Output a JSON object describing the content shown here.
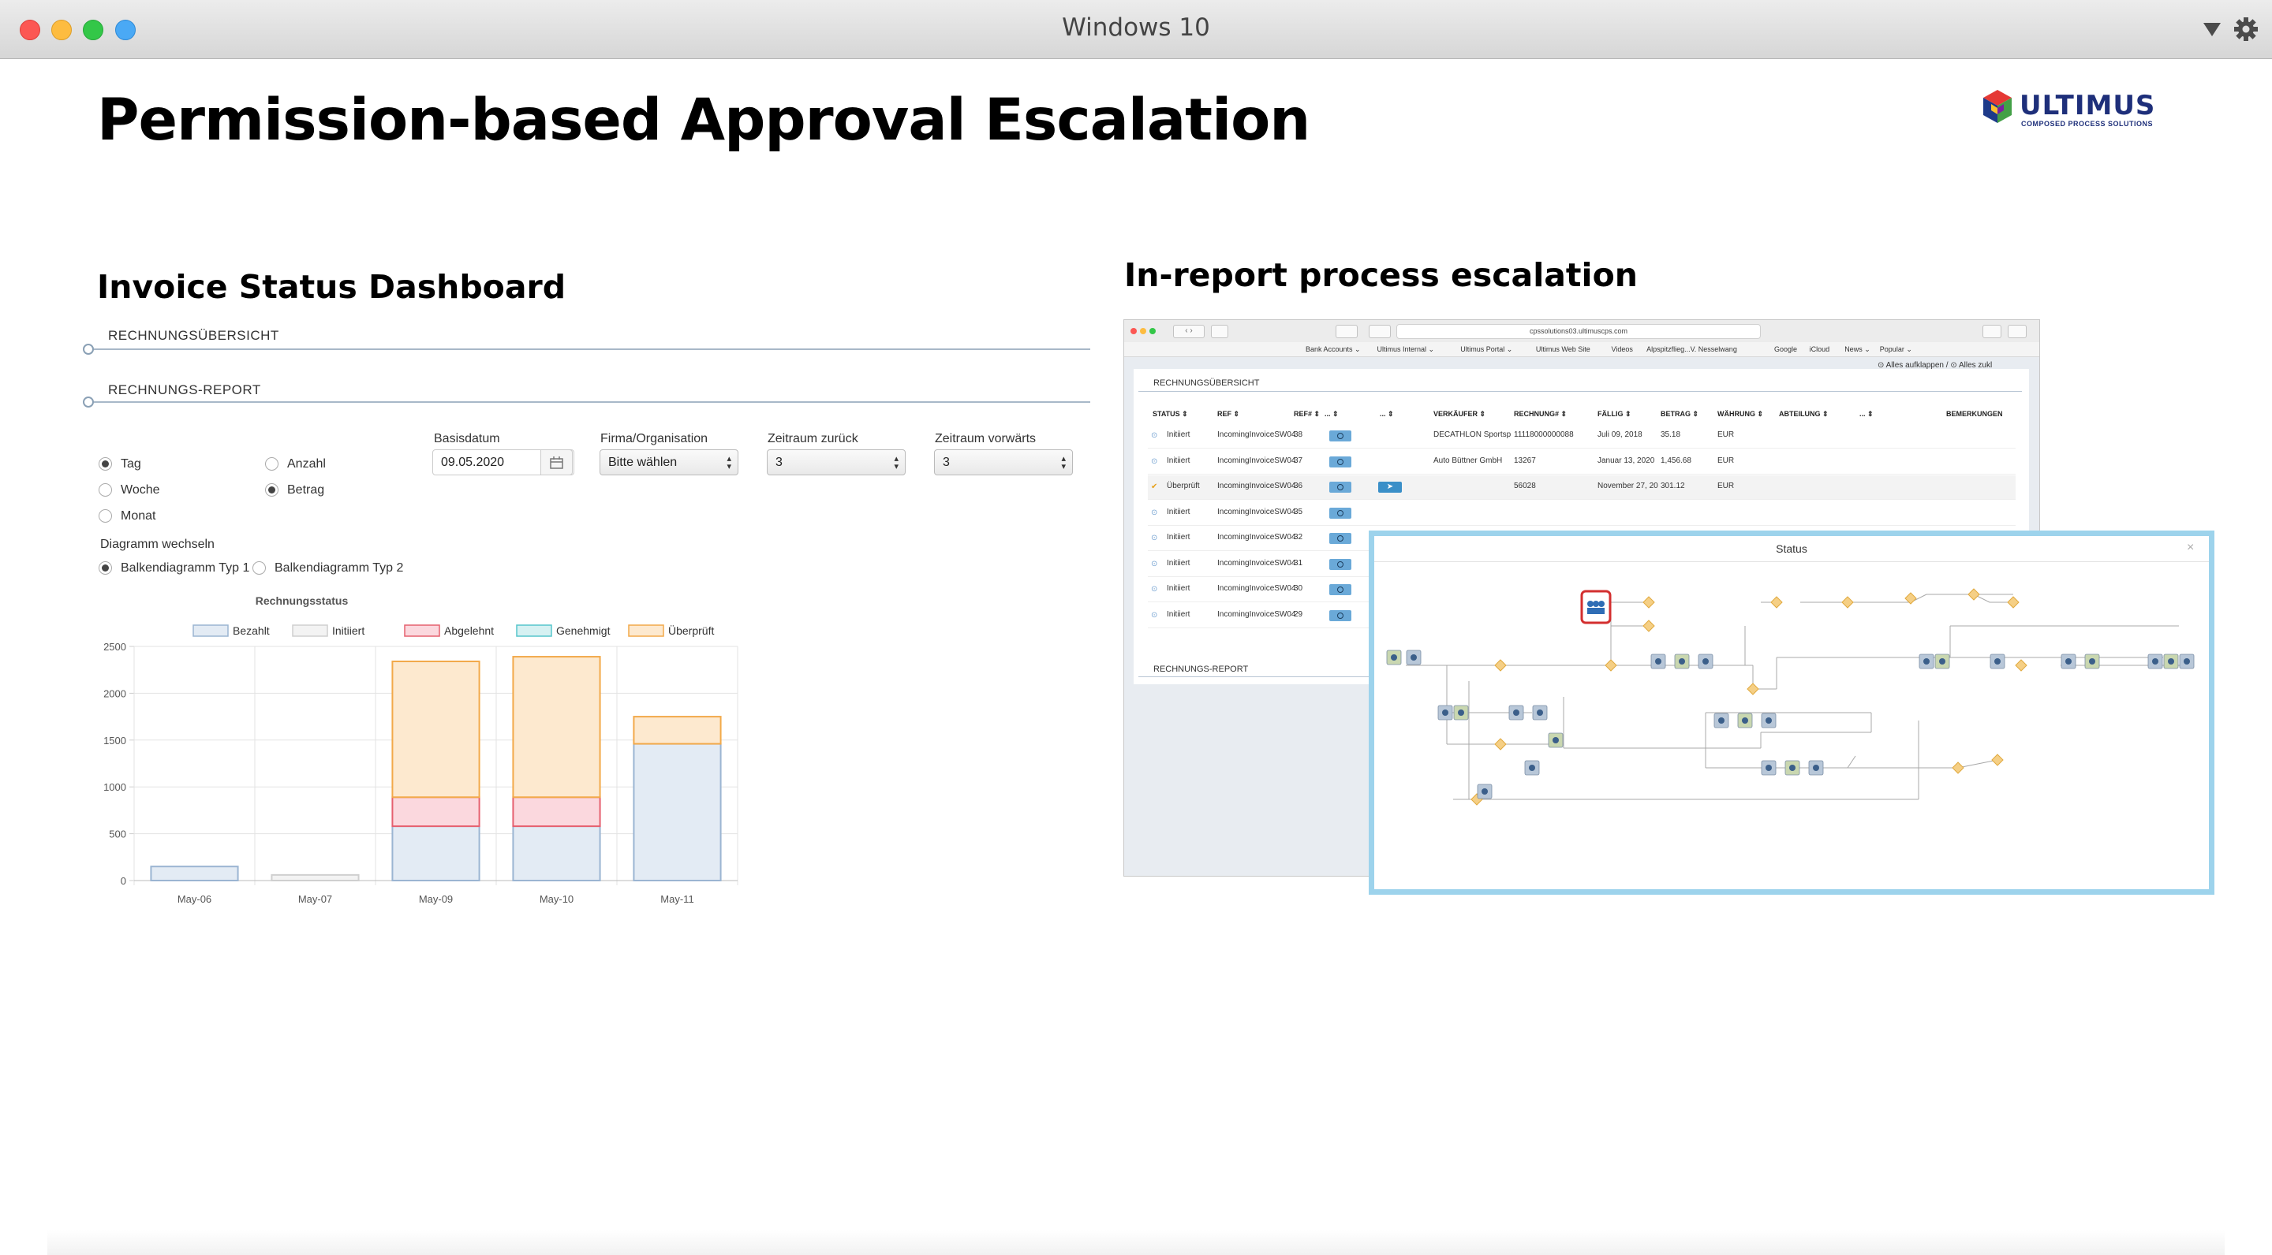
{
  "window": {
    "title": "Windows 10",
    "traffic_colors": [
      "#fc5753",
      "#fdbc40",
      "#33c748",
      "#4aa9f5"
    ]
  },
  "slide": {
    "title": "Permission-based Approval Escalation",
    "logo_text": "ULTIMUS",
    "logo_sub": "COMPOSED PROCESS SOLUTIONS"
  },
  "left": {
    "heading": "Invoice Status Dashboard",
    "section1": "RECHNUNGSÜBERSICHT",
    "section2": "RECHNUNGS-REPORT",
    "radios_period": [
      {
        "label": "Tag",
        "selected": true
      },
      {
        "label": "Woche",
        "selected": false
      },
      {
        "label": "Monat",
        "selected": false
      }
    ],
    "radios_measure": [
      {
        "label": "Anzahl",
        "selected": false
      },
      {
        "label": "Betrag",
        "selected": true
      }
    ],
    "switch_label": "Diagramm wechseln",
    "radios_chart": [
      {
        "label": "Balkendiagramm Typ 1",
        "selected": true
      },
      {
        "label": "Balkendiagramm Typ 2",
        "selected": false
      }
    ],
    "fields": {
      "basisdatum_label": "Basisdatum",
      "basisdatum_value": "09.05.2020",
      "firma_label": "Firma/Organisation",
      "firma_value": "Bitte wählen",
      "zurueck_label": "Zeitraum zurück",
      "zurueck_value": "3",
      "vorwaerts_label": "Zeitraum vorwärts",
      "vorwaerts_value": "3"
    }
  },
  "chart_data": {
    "type": "bar",
    "stacked": true,
    "title": "Rechnungsstatus",
    "categories": [
      "May-06",
      "May-07",
      "May-09",
      "May-10",
      "May-11"
    ],
    "ylim": [
      0,
      2500
    ],
    "yticks": [
      "2500",
      "2000",
      "1500",
      "1000",
      "500",
      "0"
    ],
    "series": [
      {
        "name": "Bezahlt",
        "values": [
          150,
          0,
          580,
          580,
          1460
        ],
        "fill": "#e3ebf4",
        "stroke": "#9bb5d2"
      },
      {
        "name": "Initiiert",
        "values": [
          0,
          60,
          0,
          0,
          0
        ],
        "fill": "#f3f3f3",
        "stroke": "#cfcfcf"
      },
      {
        "name": "Abgelehnt",
        "values": [
          0,
          0,
          310,
          310,
          0
        ],
        "fill": "#fbd8de",
        "stroke": "#e5606f"
      },
      {
        "name": "Genehmigt",
        "values": [
          0,
          0,
          0,
          0,
          0
        ],
        "fill": "#d6f1f2",
        "stroke": "#56c5cc"
      },
      {
        "name": "Überprüft",
        "values": [
          0,
          0,
          1450,
          1500,
          290
        ],
        "fill": "#fde9cf",
        "stroke": "#f2a94a"
      }
    ],
    "grid": true,
    "legend": "top"
  },
  "right": {
    "heading": "In-report process escalation",
    "url": "cpssolutions03.ultimuscps.com",
    "bookmarks": [
      "Bank Accounts ⌄",
      "Ultimus Internal ⌄",
      "Ultimus Portal ⌄",
      "Ultimus Web Site",
      "Videos",
      "Alpspitzflieg...V. Nesselwang",
      "Google",
      "iCloud",
      "News ⌄",
      "Popular ⌄"
    ],
    "expand_label": "Alles aufklappen /",
    "collapse_label": "Alles zukl",
    "section1": "RECHNUNGSÜBERSICHT",
    "section2": "RECHNUNGS-REPORT",
    "columns": [
      "STATUS ⇕",
      "REF ⇕",
      "REF# ⇕",
      "... ⇕",
      "... ⇕",
      "VERKÄUFER ⇕",
      "RECHNUNG# ⇕",
      "FÄLLIG ⇕",
      "BETRAG ⇕",
      "WÄHRUNG ⇕",
      "ABTEILUNG ⇕",
      "... ⇕",
      "BEMERKUNGEN"
    ],
    "rows": [
      {
        "status": "Initiiert",
        "ref": "IncomingInvoiceSW04",
        "num": "38",
        "vendor": "DECATHLON Sportsp",
        "invoice": "11118000000088",
        "due": "Juli 09, 2018",
        "amount": "35.18",
        "currency": "EUR"
      },
      {
        "status": "Initiiert",
        "ref": "IncomingInvoiceSW04",
        "num": "37",
        "vendor": "Auto Büttner GmbH",
        "invoice": "13267",
        "due": "Januar 13, 2020",
        "amount": "1,456.68",
        "currency": "EUR"
      },
      {
        "status": "Überprüft",
        "ref": "IncomingInvoiceSW04",
        "num": "36",
        "vendor": "",
        "invoice": "56028",
        "due": "November 27, 20",
        "amount": "301.12",
        "currency": "EUR"
      },
      {
        "status": "Initiiert",
        "ref": "IncomingInvoiceSW04",
        "num": "35",
        "vendor": "",
        "invoice": "",
        "due": "",
        "amount": "",
        "currency": ""
      },
      {
        "status": "Initiiert",
        "ref": "IncomingInvoiceSW04",
        "num": "32",
        "vendor": "",
        "invoice": "",
        "due": "",
        "amount": "",
        "currency": ""
      },
      {
        "status": "Initiiert",
        "ref": "IncomingInvoiceSW04",
        "num": "31",
        "vendor": "",
        "invoice": "",
        "due": "",
        "amount": "",
        "currency": ""
      },
      {
        "status": "Initiiert",
        "ref": "IncomingInvoiceSW04",
        "num": "30",
        "vendor": "",
        "invoice": "",
        "due": "",
        "amount": "",
        "currency": ""
      },
      {
        "status": "Initiiert",
        "ref": "IncomingInvoiceSW04",
        "num": "29",
        "vendor": "",
        "invoice": "",
        "due": "",
        "amount": "",
        "currency": ""
      }
    ],
    "modal_title": "Status",
    "modal_close": "×"
  }
}
